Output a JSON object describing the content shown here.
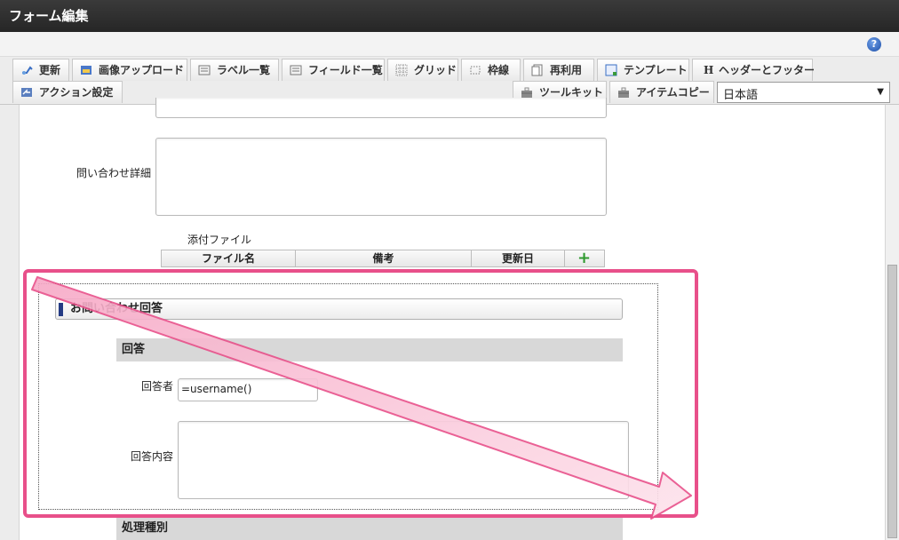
{
  "window": {
    "title": "フォーム編集"
  },
  "toolbar": {
    "row1": [
      {
        "name": "update",
        "label": "更新"
      },
      {
        "name": "image-upload",
        "label": "画像アップロード"
      },
      {
        "name": "label-list",
        "label": "ラベル一覧"
      },
      {
        "name": "field-list",
        "label": "フィールド一覧"
      },
      {
        "name": "grid",
        "label": "グリッド"
      },
      {
        "name": "border",
        "label": "枠線"
      },
      {
        "name": "reuse",
        "label": "再利用"
      },
      {
        "name": "template",
        "label": "テンプレート"
      },
      {
        "name": "header-footer",
        "label": "ヘッダーとフッター"
      }
    ],
    "row2": [
      {
        "name": "action-settings",
        "label": "アクション設定"
      },
      {
        "name": "toolkit",
        "label": "ツールキット"
      },
      {
        "name": "item-copy",
        "label": "アイテムコピー"
      }
    ],
    "language": "日本語"
  },
  "form": {
    "inquiry_detail_label": "問い合わせ詳細",
    "attachment_label": "添付ファイル",
    "attachment_columns": [
      "ファイル名",
      "備考",
      "更新日"
    ],
    "section_title": "お問い合わせ回答",
    "answer_group": "回答",
    "respondent_label": "回答者",
    "respondent_value": "=username()",
    "answer_content_label": "回答内容",
    "process_type_group": "処理種別"
  },
  "colors": {
    "accent": "#e8508a",
    "section_mark": "#243b84",
    "plus": "#2f9a2f"
  }
}
